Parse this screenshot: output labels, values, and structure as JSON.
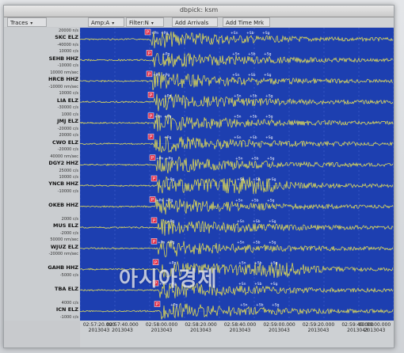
{
  "window": {
    "title": "dbpick: ksm"
  },
  "toolbar": {
    "traces": "Traces",
    "amp": "Amp:A",
    "filter": "Filter:N",
    "add_arrivals": "Add Arrivals",
    "add_time_mrk": "Add Time Mrk"
  },
  "stations": [
    {
      "name": "SKC ELZ",
      "amps": [
        "20000 n/s",
        "-40000 n/s"
      ]
    },
    {
      "name": "SEHB HHZ",
      "amps": [
        "10000 c/s",
        "-10000 c/s"
      ]
    },
    {
      "name": "HRCB HHZ",
      "amps": [
        "10000 nm/sec",
        "-10000 nm/sec"
      ]
    },
    {
      "name": "LIA ELZ",
      "amps": [
        "10000 c/s",
        "-30000 c/s"
      ]
    },
    {
      "name": "JMJ ELZ",
      "amps": [
        "1000 c/s",
        "-20000 c/s"
      ]
    },
    {
      "name": "CWO ELZ",
      "amps": [
        "20000 c/s",
        "-20000 c/s"
      ]
    },
    {
      "name": "DGY2 HHZ",
      "amps": [
        "40000 nm/sec",
        "25000 c/s"
      ]
    },
    {
      "name": "YNCB HHZ",
      "amps": [
        "10000 c/s",
        "-10000 c/s"
      ]
    },
    {
      "name": "OKEB HHZ",
      "amps": [
        "",
        ""
      ]
    },
    {
      "name": "MUS ELZ",
      "amps": [
        "2000 c/s",
        "-2000 c/s"
      ]
    },
    {
      "name": "WJUZ ELZ",
      "amps": [
        "50000 nm/sec",
        "-20000 nm/sec"
      ]
    },
    {
      "name": "GAHB HHZ",
      "amps": [
        "",
        "-5000 c/s"
      ]
    },
    {
      "name": "TBA ELZ",
      "amps": [
        "",
        ""
      ]
    },
    {
      "name": "ICN ELZ",
      "amps": [
        "4000 c/s",
        "-1000 c/s"
      ]
    }
  ],
  "picks": {
    "p": "P",
    "labels": [
      "+Pn",
      "+Pg",
      "+Sn",
      "+Sb",
      "+Sg"
    ]
  },
  "time_axis": {
    "ticks": [
      {
        "time": "02:57:20.000",
        "date": "2013043"
      },
      {
        "time": "02:57:40.000",
        "date": "2013043"
      },
      {
        "time": "02:58:00.000",
        "date": "2013043"
      },
      {
        "time": "02:58:20.000",
        "date": "2013043"
      },
      {
        "time": "02:58:40.000",
        "date": "2013043"
      },
      {
        "time": "02:59:00.000",
        "date": "2013043"
      },
      {
        "time": "02:59:20.000",
        "date": "2013043"
      },
      {
        "time": "02:59:40.000",
        "date": "2013043"
      },
      {
        "time": "03:00:00.000",
        "date": "2013043"
      }
    ]
  },
  "colors": {
    "plot_bg": "#1d3fb0",
    "trace": "#f1e84a",
    "pick_box": "#e0304a",
    "axis_line": "#e8e8e8"
  },
  "watermark": "아시아경제"
}
